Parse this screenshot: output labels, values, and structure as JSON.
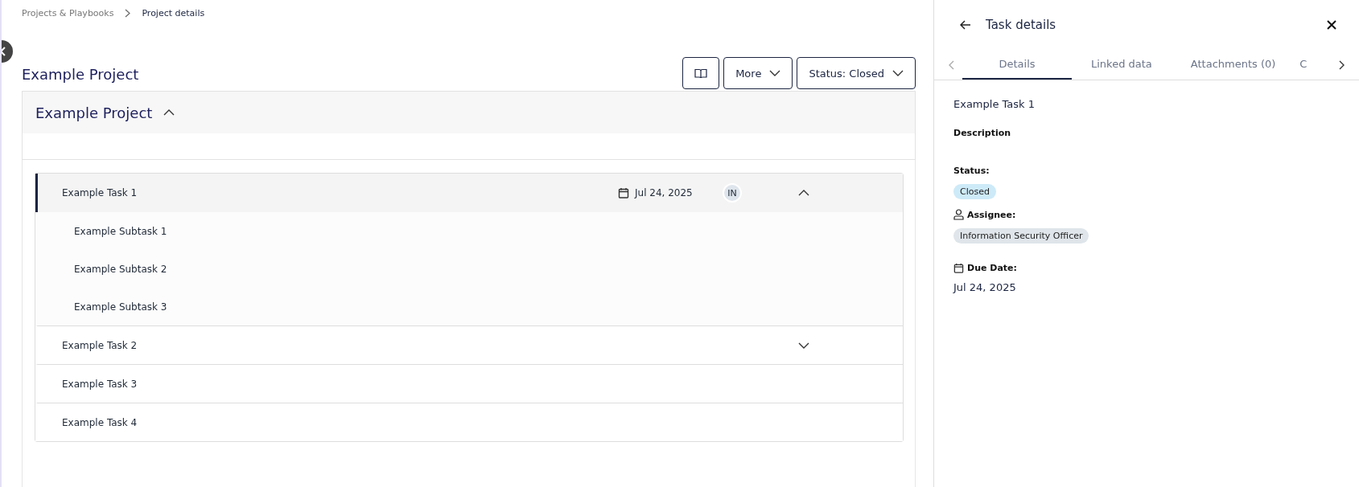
{
  "breadcrumb": [
    {
      "label": "Projects & Playbooks",
      "current": false
    },
    {
      "label": "Project details",
      "current": true
    }
  ],
  "page_title": "Example Project",
  "toolbar": {
    "more_label": "More",
    "status_label": "Status: Closed"
  },
  "project": {
    "title": "Example Project",
    "expanded": true
  },
  "tasks": [
    {
      "title": "Example Task 1",
      "selected": true,
      "expanded": true,
      "due": "Jul 24, 2025",
      "assignee_initials": "IN",
      "subtasks": [
        {
          "title": "Example Subtask 1"
        },
        {
          "title": "Example Subtask 2"
        },
        {
          "title": "Example Subtask 3"
        }
      ]
    },
    {
      "title": "Example Task 2",
      "selected": false,
      "expanded": false
    },
    {
      "title": "Example Task 3",
      "selected": false
    },
    {
      "title": "Example Task 4",
      "selected": false
    }
  ],
  "panel": {
    "title": "Task details",
    "tabs": [
      {
        "label": "Details",
        "selected": true
      },
      {
        "label": "Linked data",
        "selected": false
      },
      {
        "label": "Attachments (0)",
        "selected": false
      },
      {
        "label": "C",
        "selected": false
      }
    ],
    "task_title": "Example Task 1",
    "description_label": "Description",
    "status_label": "Status:",
    "status_value": "Closed",
    "assignee_label": "Assignee:",
    "assignee_value": "Information Security Officer",
    "due_label": "Due Date:",
    "due_value": "Jul 24, 2025"
  }
}
